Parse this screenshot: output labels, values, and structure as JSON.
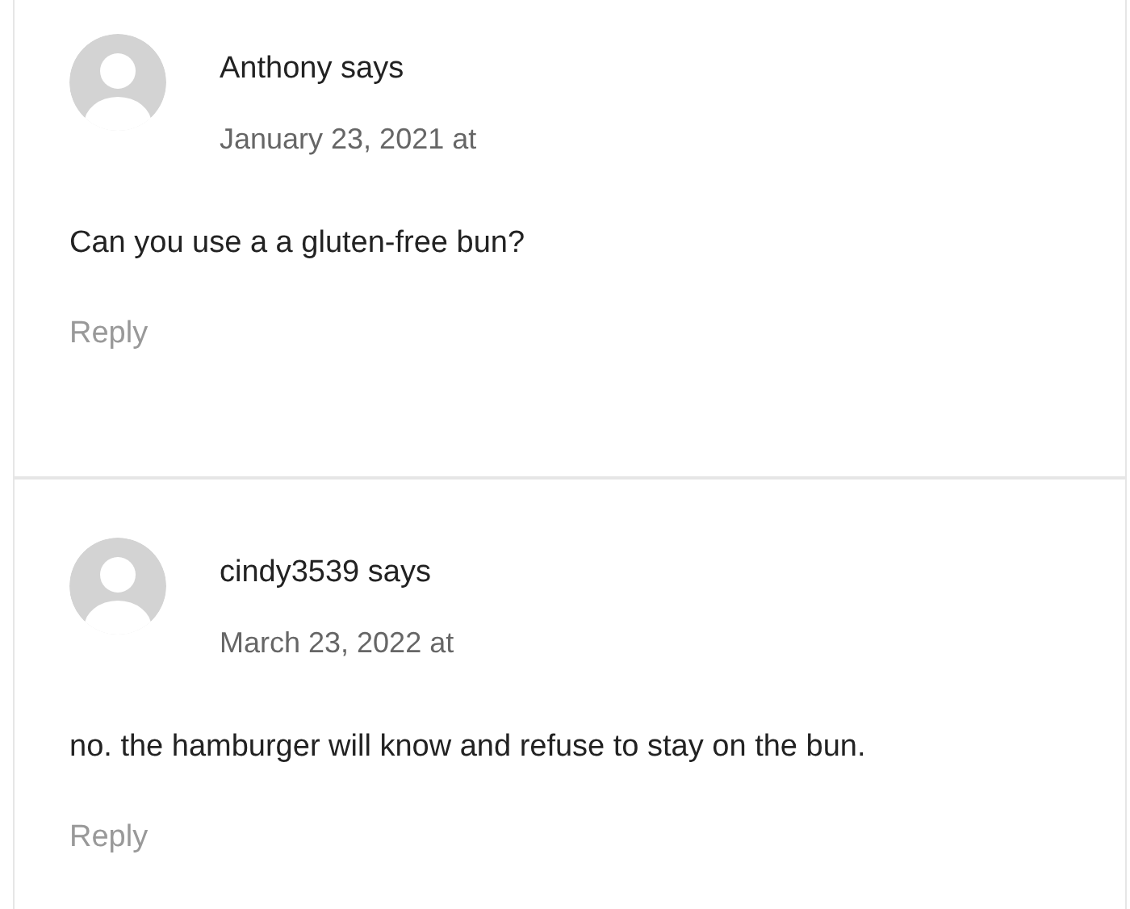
{
  "comments": [
    {
      "author_line": "Anthony says",
      "date": "January 23, 2021 at",
      "text": "Can you use a a gluten-free bun?",
      "reply": "Reply"
    },
    {
      "author_line": "cindy3539 says",
      "date": "March 23, 2022 at",
      "text": "no. the hamburger will know and refuse to stay on the bun.",
      "reply": "Reply"
    }
  ]
}
